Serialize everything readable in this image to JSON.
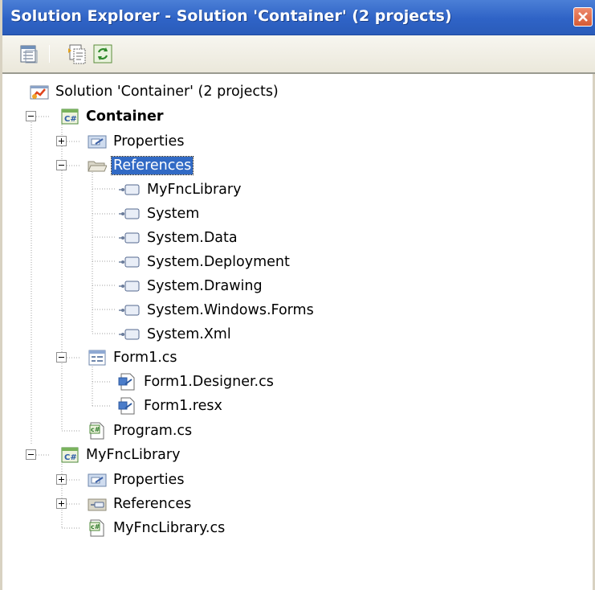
{
  "window": {
    "title": "Solution Explorer - Solution 'Container' (2 projects)"
  },
  "toolbar": {
    "buttons": [
      {
        "name": "properties-icon"
      },
      {
        "name": "show-all-files-icon"
      },
      {
        "name": "refresh-icon"
      }
    ]
  },
  "tree": {
    "solution": "Solution 'Container' (2 projects)",
    "project1": {
      "label": "Container",
      "properties": "Properties",
      "references": "References",
      "ref_items": [
        "MyFncLibrary",
        "System",
        "System.Data",
        "System.Deployment",
        "System.Drawing",
        "System.Windows.Forms",
        "System.Xml"
      ],
      "form1": "Form1.cs",
      "form1_designer": "Form1.Designer.cs",
      "form1_resx": "Form1.resx",
      "program": "Program.cs"
    },
    "project2": {
      "label": "MyFncLibrary",
      "properties": "Properties",
      "references": "References",
      "source": "MyFncLibrary.cs"
    }
  },
  "colors": {
    "titlebar": "#2f63c6",
    "selection": "#316ac5",
    "close_button": "#d55a35"
  }
}
